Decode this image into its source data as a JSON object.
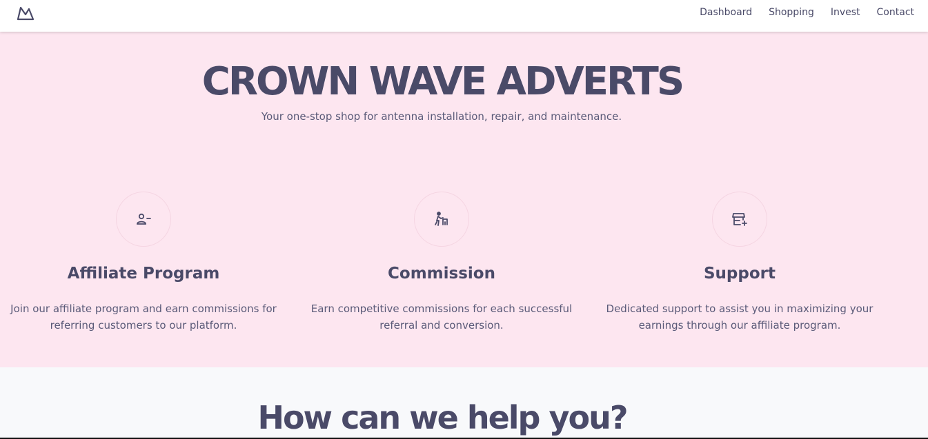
{
  "nav": {
    "logo_icon": "mountain-logo-icon",
    "links": [
      "Dashboard",
      "Shopping",
      "Invest",
      "Contact"
    ]
  },
  "hero": {
    "title": "CROWN WAVE ADVERTS",
    "subtitle": "Your one-stop shop for antenna installation, repair, and maintenance."
  },
  "features": [
    {
      "icon": "user-minus-icon",
      "title": "Affiliate Program",
      "description": "Join our affiliate program and earn commissions for referring customers to our platform."
    },
    {
      "icon": "person-walking-icon",
      "title": "Commission",
      "description": "Earn competitive commissions for each successful referral and conversion."
    },
    {
      "icon": "store-plus-icon",
      "title": "Support",
      "description": "Dedicated support to assist you in maximizing your earnings through our affiliate program."
    }
  ],
  "help": {
    "title": "How can we help you?"
  },
  "colors": {
    "hero_bg": "#fde6f0",
    "text": "#4a4a68",
    "section_bg": "#f8f9fb"
  }
}
